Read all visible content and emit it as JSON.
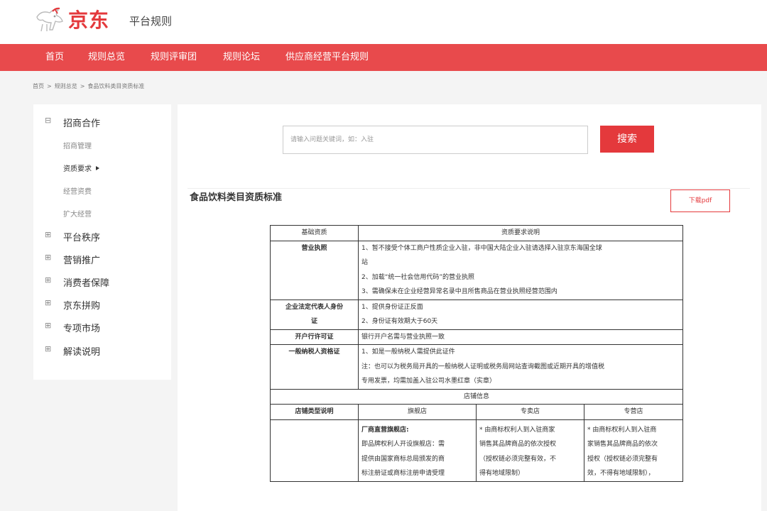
{
  "header": {
    "logo_text": "京东",
    "subtitle": "平台规则",
    "logo_icon": "jd-dog-icon"
  },
  "nav": {
    "items": [
      "首页",
      "规则总览",
      "规则评审团",
      "规则论坛",
      "供应商经营平台规则"
    ]
  },
  "breadcrumb": {
    "items": [
      "首页",
      "规则总览",
      "食品饮料类目资质标准"
    ],
    "separator": ">"
  },
  "sidebar": {
    "expanded_sign": "⊟",
    "collapsed_sign": "⊞",
    "section_open": "招商合作",
    "sub_items": [
      "招商管理",
      "资质要求",
      "经营资费",
      "扩大经营"
    ],
    "sections_closed": [
      "平台秩序",
      "营销推广",
      "消费者保障",
      "京东拼购",
      "专项市场",
      "解读说明"
    ]
  },
  "search": {
    "placeholder": "请输入问题关键词，如：入驻",
    "button": "搜索"
  },
  "article": {
    "title": "食品饮料类目资质标准",
    "download_button": "下载pdf"
  },
  "table": {
    "header": [
      "基础资质",
      "资质要求说明"
    ],
    "license": {
      "label": "营业执照",
      "lines": [
        "1、暂不接受个体工商户性质企业入驻，非中国大陆企业入驻请选择入驻京东海国全球",
        "站",
        "2、加载“统一社会信用代码”的营业执照",
        "3、需确保未在企业经营异常名录中且所售商品在营业执照经营范围内"
      ]
    },
    "legal_rep": {
      "label_lines": [
        "企业法定代表人身份",
        "证"
      ],
      "lines": [
        "1、提供身份证正反面",
        "2、身份证有效期大于60天"
      ]
    },
    "bank_permit": {
      "label": "开户行许可证",
      "value": "银行开户名需与营业执照一致"
    },
    "taxpayer": {
      "label": "一般纳税人资格证",
      "lines": [
        "1、如是一般纳税人需提供此证件",
        "注：也可以为税务局开具的一般纳税人证明或税务局网站查询截图或近期开具的增值税",
        "专用发票，均需加盖入驻公司水墨红章（实章）"
      ]
    },
    "store_info": "店铺信息",
    "store_types": {
      "label": "店铺类型说明",
      "columns": [
        "旗舰店",
        "专卖店",
        "专营店"
      ]
    },
    "store_desc": {
      "flagship_title": "厂商直营旗舰店:",
      "flagship_lines": [
        "即品牌权利人开设旗舰店：需",
        "提供由国家商标总局颁发的商",
        "标注册证或商标注册申请受理"
      ],
      "exclusive_lines": [
        "* 由商标权利人到入驻商家",
        "销售其品牌商品的依次授权",
        "（授权链必须完整有效，不",
        "得有地域限制）"
      ],
      "specialty_lines": [
        "* 由商标权利人到入驻商",
        "家销售其品牌商品的依次",
        "授权（授权链必须完整有",
        "效，不得有地域限制），"
      ]
    }
  }
}
